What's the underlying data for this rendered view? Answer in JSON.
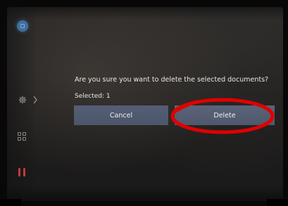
{
  "dialog": {
    "message": "Are you sure you want to delete the selected documents?",
    "selected": "Selected: 1",
    "cancel_label": "Cancel",
    "delete_label": "Delete"
  },
  "sidebar": {
    "items": [
      {
        "icon": "profile-icon"
      },
      {
        "icon": "gear-icon"
      },
      {
        "icon": "apps-grid-icon"
      },
      {
        "icon": "pause-icon"
      }
    ]
  },
  "colors": {
    "button_bg": "#4f586c",
    "annotation_ring": "#e00000",
    "pause_icon": "#c03b3b"
  }
}
